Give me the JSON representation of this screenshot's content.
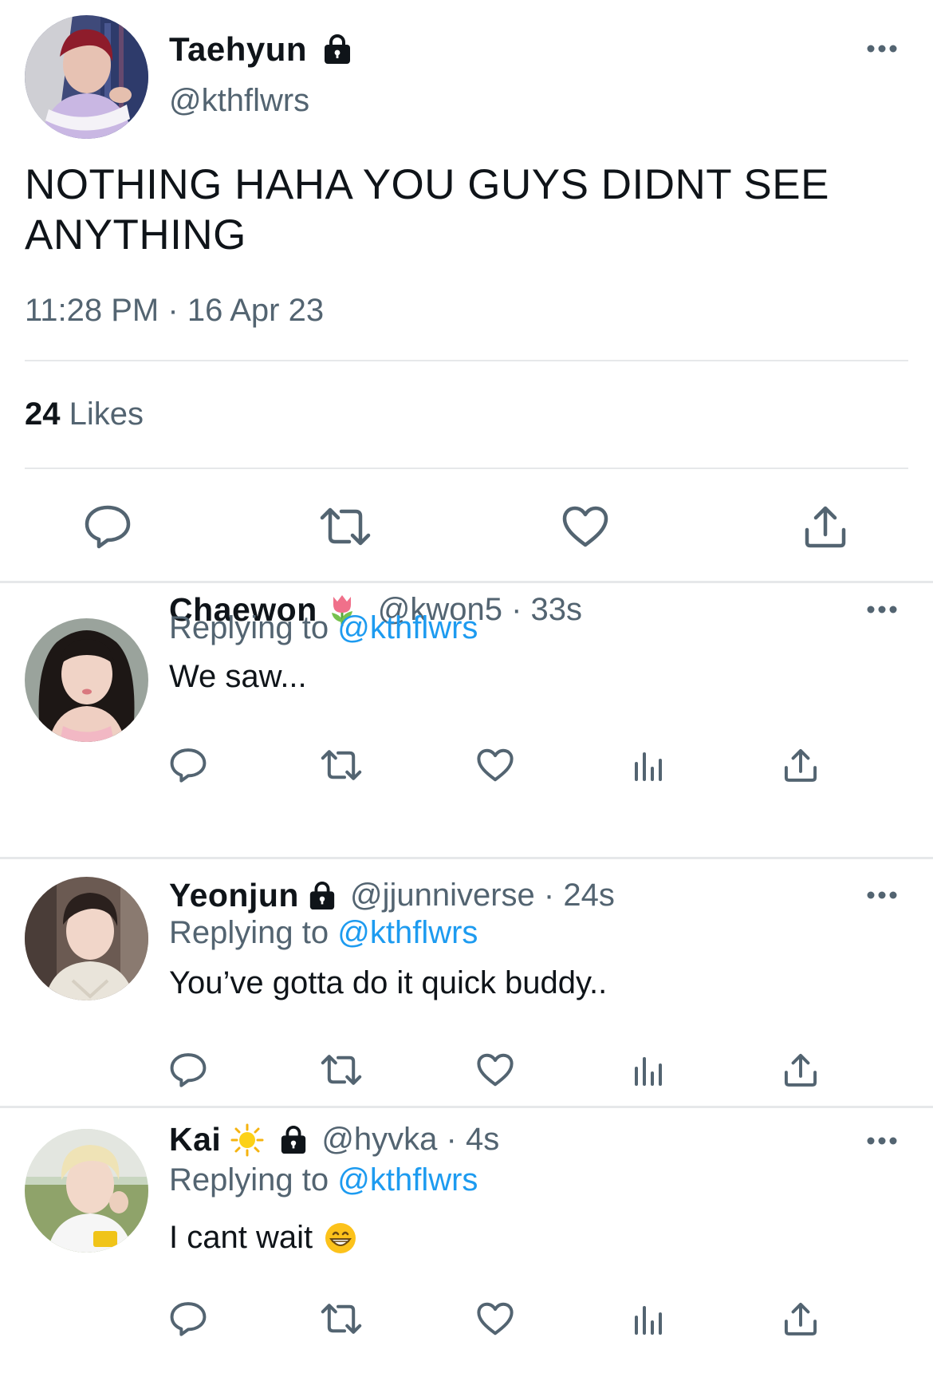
{
  "main_tweet": {
    "display_name": "Taehyun",
    "handle": "@kthflwrs",
    "text": "NOTHING HAHA YOU GUYS DIDNT SEE ANYTHING",
    "time": "11:28 PM",
    "separator": "·",
    "date": "16 Apr 23",
    "likes_count": "24",
    "likes_label": "Likes",
    "protected": true
  },
  "replies": [
    {
      "display_name": "Chaewon",
      "name_emoji": "tulip-emoji",
      "handle_time": "@kwon5 · 33s",
      "replying_prefix": "Replying to",
      "replying_to": "@kthflwrs",
      "text": "We saw...",
      "protected": false
    },
    {
      "display_name": "Yeonjun",
      "handle_time": "@jjunniverse · 24s",
      "replying_prefix": "Replying to",
      "replying_to": "@kthflwrs",
      "text": "You’ve gotta do it quick buddy..",
      "protected": true
    },
    {
      "display_name": "Kai",
      "name_emoji": "sun-emoji",
      "handle_time": "@hyvka · 4s",
      "replying_prefix": "Replying to",
      "replying_to": "@kthflwrs",
      "text": "I cant wait",
      "text_emoji": "grinning-face-emoji",
      "protected": true
    }
  ],
  "colors": {
    "text_primary": "#0f1419",
    "text_secondary": "#536471",
    "link": "#1d9bf0",
    "divider": "#e6e8ea",
    "icon": "#536471"
  },
  "icons": [
    "more-icon",
    "lock-icon",
    "reply-icon",
    "retweet-icon",
    "like-icon",
    "views-icon",
    "share-icon"
  ]
}
